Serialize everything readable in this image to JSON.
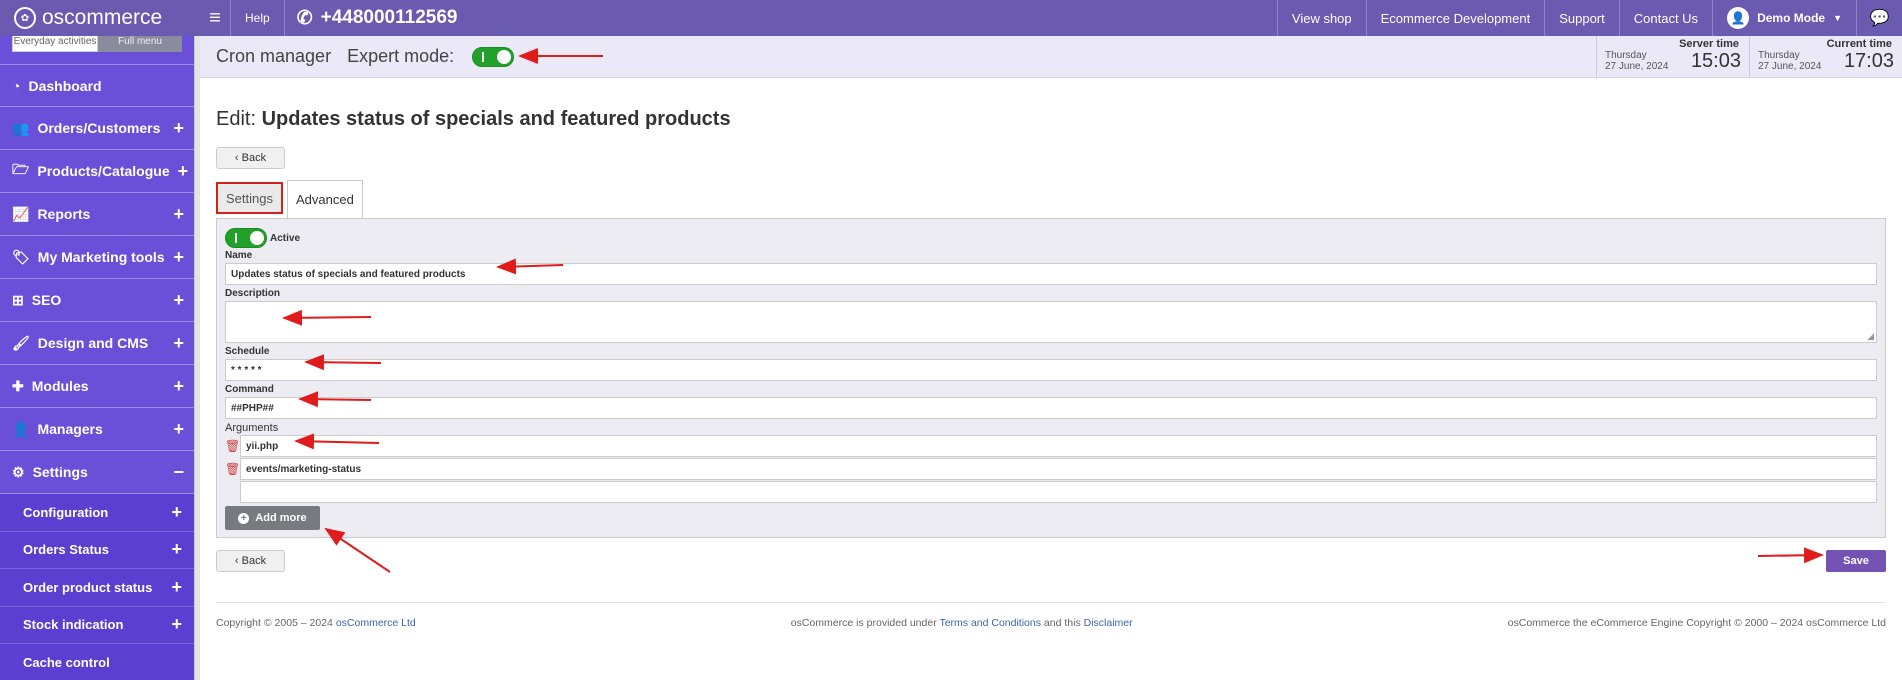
{
  "topbar": {
    "logo": "oscommerce",
    "help": "Help",
    "phone": "+448000112569",
    "links": [
      "View shop",
      "Ecommerce Development",
      "Support",
      "Contact Us"
    ],
    "user": "Demo Mode"
  },
  "sidebar": {
    "switch": [
      "Everyday activities",
      "Full menu"
    ],
    "items": [
      {
        "label": "Dashboard",
        "icon": "dashboard-icon",
        "expand": ""
      },
      {
        "label": "Orders/Customers",
        "icon": "users-icon",
        "expand": "+"
      },
      {
        "label": "Products/Catalogue",
        "icon": "folder-icon",
        "expand": "+"
      },
      {
        "label": "Reports",
        "icon": "chart-icon",
        "expand": "+"
      },
      {
        "label": "My Marketing tools",
        "icon": "tag-icon",
        "expand": "+"
      },
      {
        "label": "SEO",
        "icon": "sitemap-icon",
        "expand": "+"
      },
      {
        "label": "Design and CMS",
        "icon": "brush-icon",
        "expand": "+"
      },
      {
        "label": "Modules",
        "icon": "puzzle-icon",
        "expand": "+"
      },
      {
        "label": "Managers",
        "icon": "user-icon",
        "expand": "+"
      },
      {
        "label": "Settings",
        "icon": "cogs-icon",
        "expand": "−"
      }
    ],
    "subitems": [
      {
        "label": "Configuration",
        "expand": "+"
      },
      {
        "label": "Orders Status",
        "expand": "+"
      },
      {
        "label": "Order product status",
        "expand": "+"
      },
      {
        "label": "Stock indication",
        "expand": "+"
      },
      {
        "label": "Cache control",
        "expand": ""
      }
    ]
  },
  "header": {
    "title": "Cron manager",
    "expert_mode": "Expert mode:",
    "server_time": {
      "label": "Server time",
      "day": "Thursday",
      "date": "27 June, 2024",
      "time": "15:03"
    },
    "current_time": {
      "label": "Current time",
      "day": "Thursday",
      "date": "27 June, 2024",
      "time": "17:03"
    }
  },
  "main": {
    "edit_prefix": "Edit:",
    "edit_title": "Updates status of specials and featured products",
    "back": "‹ Back",
    "tabs": [
      "Settings",
      "Advanced"
    ],
    "active_label": "Active",
    "name_label": "Name",
    "name_value": "Updates status of specials and featured products",
    "description_label": "Description",
    "description_value": "",
    "schedule_label": "Schedule",
    "schedule_value": "* * * * *",
    "command_label": "Command",
    "command_value": "##PHP##",
    "arguments_label": "Arguments",
    "arguments": [
      "yii.php",
      "events/marketing-status",
      ""
    ],
    "add_more": "Add more",
    "save": "Save"
  },
  "footer": {
    "left_text": "Copyright © 2005 – 2024 ",
    "left_link": "osCommerce Ltd",
    "center_pre": "osCommerce is provided under ",
    "center_link1": "Terms and Conditions",
    "center_mid": " and this ",
    "center_link2": "Disclaimer",
    "right_text": "osCommerce the eCommerce Engine Copyright © 2000 – 2024 osCommerce Ltd"
  },
  "colors": {
    "brand": "#6a5ab0",
    "sidebar": "#6a4fd8",
    "toggle_on": "#22a12a",
    "save": "#7352b4",
    "annotation": "#e01b1b"
  }
}
